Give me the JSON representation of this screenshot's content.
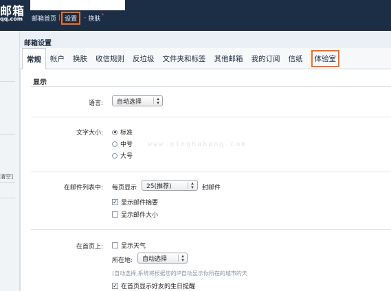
{
  "header": {
    "logo_title": "邮箱",
    "logo_domain": "qq.com",
    "nav": [
      {
        "label": "邮箱首页"
      },
      {
        "label": "设置"
      },
      {
        "label": "换肤"
      }
    ],
    "new_dot": "*",
    "accent_color": "#ff6c1a"
  },
  "left": {
    "clipped_label": "清空]"
  },
  "panel": {
    "title": "邮箱设置"
  },
  "tabs": [
    {
      "label": "常规"
    },
    {
      "label": "帐户"
    },
    {
      "label": "换肤"
    },
    {
      "label": "收信规则"
    },
    {
      "label": "反垃圾"
    },
    {
      "label": "文件夹和标签"
    },
    {
      "label": "其他邮箱"
    },
    {
      "label": "我的订阅"
    },
    {
      "label": "信纸"
    },
    {
      "label": "体验室"
    }
  ],
  "section": {
    "title": "显示"
  },
  "language": {
    "label": "语言:",
    "value": "自动选择"
  },
  "font_size": {
    "label": "文字大小:",
    "options": [
      {
        "label": "标准",
        "selected": true
      },
      {
        "label": "中号",
        "selected": false
      },
      {
        "label": "大号",
        "selected": false
      }
    ]
  },
  "mail_list": {
    "label": "在邮件列表中:",
    "per_page_prefix": "每页显示",
    "per_page_value": "25(推荐)",
    "per_page_suffix": "封邮件",
    "show_summary": {
      "label": "显示邮件摘要",
      "checked": true
    },
    "show_size": {
      "label": "显示邮件大小",
      "checked": false
    }
  },
  "homepage": {
    "label": "在首页上:",
    "show_weather": {
      "label": "显示天气",
      "checked": false
    },
    "location_label": "所在地:",
    "location_value": "自动选择",
    "location_note": "(自动选择,系统将根据您的IP自动显示你所在的城市的天",
    "birthday": {
      "label": "在首页显示好友的生日提醒",
      "checked": true
    }
  },
  "watermark": "www.qinghuhang.com"
}
